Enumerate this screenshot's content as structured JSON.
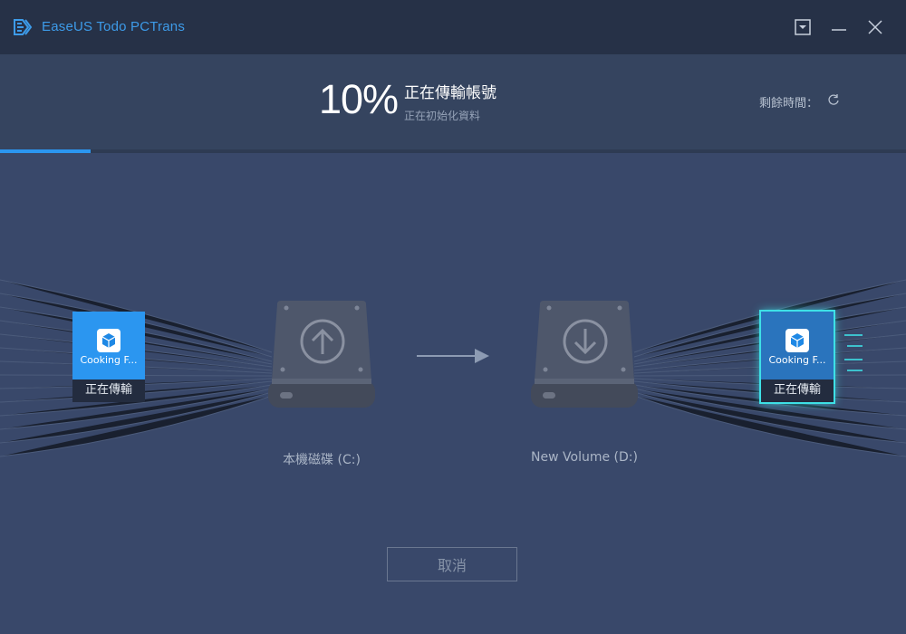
{
  "window": {
    "app_title": "EaseUS Todo PCTrans",
    "icons": [
      "logo-icon",
      "dropdown-icon",
      "minimize-icon",
      "close-icon"
    ]
  },
  "progress": {
    "percent_text": "10%",
    "percent_value": 10,
    "title": "正在傳輸帳號",
    "subtitle": "正在初始化資料",
    "remaining_label": "剩餘時間：",
    "remaining_icon": "refresh-icon"
  },
  "source_item": {
    "name": "Cooking F...",
    "status": "正在傳輸",
    "icon": "cube-icon"
  },
  "target_item": {
    "name": "Cooking F...",
    "status": "正在傳輸",
    "icon": "cube-icon"
  },
  "source_drive": {
    "label": "本機磁碟 (C:)",
    "icon": "upload-drive-icon"
  },
  "target_drive": {
    "label": "New Volume (D:)",
    "icon": "download-drive-icon"
  },
  "actions": {
    "cancel_label": "取消"
  },
  "colors": {
    "accent": "#2b96f0",
    "titlebar": "#263147",
    "highlight": "#3ee0e6"
  }
}
